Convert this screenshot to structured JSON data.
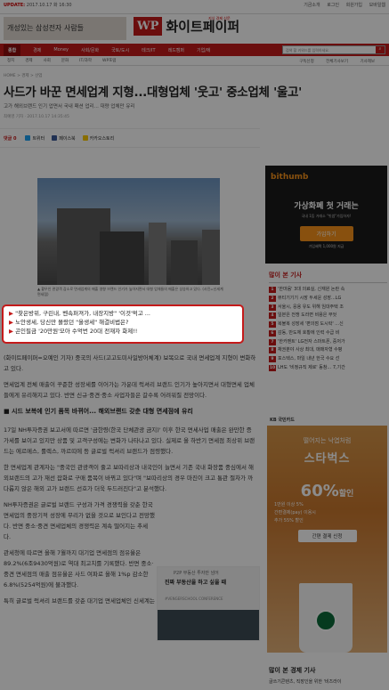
{
  "topbar": {
    "update_label": "UPDATE:",
    "update_time": "2017.10.17 화 16:30",
    "links": [
      "기금소개",
      "로그인",
      "회원가입",
      "모바일웹"
    ]
  },
  "header": {
    "ad_text": "개성있는 삼성전자 사람들",
    "logo_mark": "WP",
    "logo_name": "화이트페이퍼",
    "slogan": "지식 경제 신문"
  },
  "nav": {
    "home": "종합",
    "items": [
      "경제",
      "Money",
      "사회/문화",
      "국토/도시",
      "테크/IT",
      "레드캠퍼",
      "기업/에"
    ],
    "search_placeholder": "검색 할 키워드를 입력하세요.",
    "search_icon": "search-icon"
  },
  "subnav": {
    "items": [
      "정치",
      "경제",
      "사회",
      "문화",
      "IT/과학",
      "WP포럼"
    ],
    "right": [
      "구독신청",
      "전체기사보기",
      "기사제보"
    ]
  },
  "breadcrumb": "HOME > 경제 > 산업",
  "article": {
    "headline": "사드가 바꾼 면세업계 지형...대형업체 '웃고' 중소업체 '울고'",
    "subheadline": "고가 해외브랜드 인기 업면서 국내 패션 업리... 대량 업체만 유리",
    "byline": "최예영 기자 · 2017.10.17 14:35:45",
    "share": {
      "comments_label": "댓글",
      "comments_count": "0",
      "buttons": [
        "트위터",
        "페이스북",
        "카카오스토리"
      ]
    },
    "caption": "▲ 황우인 관광객 감소로 면세업계의 매출 영향 브랜드 인기가 높아지면서 대형 업체들의 매출은 상승하고 있다. (사진=신세계면세점)",
    "related": [
      "\"찾은방위, 구린내, 벤속퍼져가, 내장지방\" '이것'먹고 ...",
      "노안생세, 당신만 몰랐던 \"올생세\" 해결비법은?",
      "곤인필금 '20만원'모아 수억번 20대 전재자 화제!!"
    ],
    "paragraphs": [
      "(화이트페이퍼=오예인 기자) 중국의 사드(고고도미사일방어체계) 보복으로 국내 면세업계 지형이 변화하고 있다.",
      "면세업계 전체 매출이 꾸준한 성장세를 이어가는 가운데 럭셔리 브랜드 인기가 높아지면서 대형면세 업체들에게 유리해지고 있다. 반면 신규·중견·중소 사업자들은 갈수록 어려워질 전망이다.",
      "■ 시드 보복에 인기 품목 바뀌어... 해외브랜드 갖춘 대형 면세점에 유리",
      "17일 NH투자증권 보고서에 따르면 '금한령(한국 단체관광 금지)' 이후 한국 면세사업 매출은 완만한 증가세를 보이고 있지만 상품 및 고객구성에는 변화가 나타나고 있다. 실제로 올 하반기 면세점 최상위 브랜드는 에르메스, 롤렉스, 까르띠에 등 글로벌 럭셔리 브랜드가 점령했다.",
      "한 면세업계 관계자는 \"중국인 관광객이 줄고 보따리상과 내국인이 늘면서 기존 국내 화장품 중심에서 해외브랜드의 고가 재선 잡화로 구매 품목이 바뀌고 있다\"며 \"보따리상의 경우 마진이 크고 통관 절차가 까다롭지 않은 해외 고가 브랜드 선호가 더욱 두드러진다\"고 분석했다.",
      "NH투자증권은 글로벌 브랜드 구성과 가격 경쟁력을 갖춘 한국 면세업의 중장기적 성장에 무리가 없을 것으로 보인다고 전망했다. 반면 중소·중견 면세업체의 경쟁력은 계속 떨어지는 추세다.",
      "관세청에 따르면 올해 7월까지 대기업 면세점의 점유율은 89.2%(6조9430억원)로 역대 최고치를 기록했다. 반면 중소·중견 면세점의 매출 점유율은 사드 여파로 올해 1%p 감소한 6.8%(5254억원)에 불과했다.",
      "특히 글로벌 럭셔리 브랜드를 갖춘 대기업 면세업체인 신세계는 7월 매출 기준 업"
    ]
  },
  "ad_mid": {
    "t1": "P2P 부동산 투자만 넘어",
    "t2": "진짜 부동산을 하고 싶을 때",
    "t3": "#VENGERSCHOOL CONFERENCE"
  },
  "ad_bithumb": {
    "logo": "bithumb",
    "title": "가상화폐 첫 거래는",
    "sub": "국내 1등 거래소 \"빗썸\"가입하자!",
    "button": "가입하기",
    "note": "가입혜택 1,000원 지급"
  },
  "popular": {
    "title": "많이 본 기사",
    "items": [
      "'한마음' 3대 의료실, 신재원 논란 속",
      "뷰티기기기 시장 두세운 성장...LG",
      "서울시, 응용 유도 위해 임대주택 조",
      "일본은 전쟁 도라면 비용은 무엇",
      "복불복 성장세 '편의점 도시락' ...신",
      "감동, 반도체 호황에 인력 수급 비",
      "'한카멘트' LG전자 스마트폰, 중저가",
      "채권분야 사상 최대, 매매자형 수평",
      "포스텍스, 마일 내년 한국 수요 선",
      "LH도 '비정규직 제로' 동참... 7,기간"
    ]
  },
  "ad_kb": {
    "header": "KB 국민카드",
    "g1": "떨어지는 낙엽처럼",
    "g2": "스타벅스",
    "pct": "60%",
    "pct_suffix": "할인",
    "lines": [
      "1만원 이상 5%",
      "간편결제(pay) 이용시",
      "추가 55% 할인"
    ],
    "button": "간편 결제 신청"
  },
  "economy": {
    "title": "많이 본 경제 기사",
    "first": "글쓰기콘텐츠, 직장인을 위한 '비즈라이"
  }
}
